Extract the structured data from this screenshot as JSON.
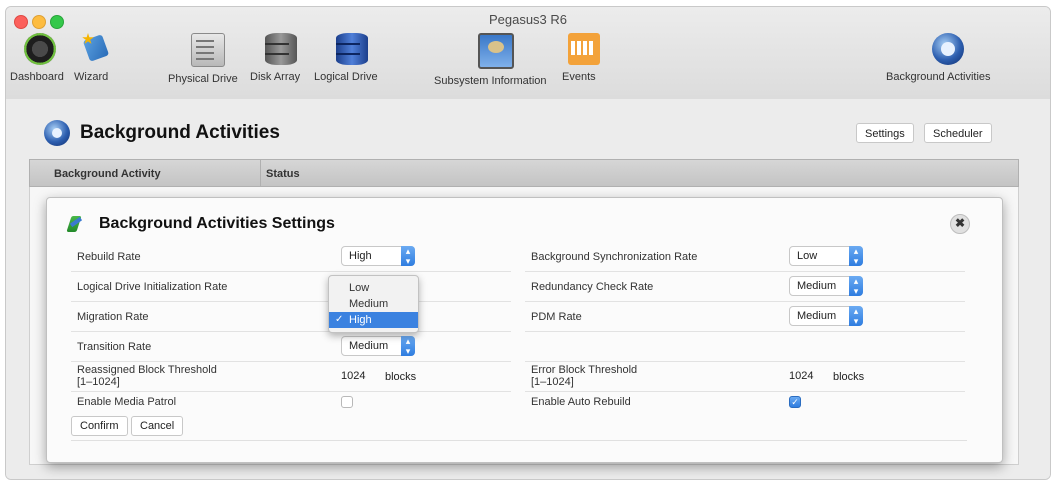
{
  "window": {
    "title": "Pegasus3 R6"
  },
  "toolbar": {
    "dashboard": "Dashboard",
    "wizard": "Wizard",
    "physical_drive": "Physical Drive",
    "disk_array": "Disk Array",
    "logical_drive": "Logical Drive",
    "subsystem_information": "Subsystem Information",
    "events": "Events",
    "background_activities": "Background Activities"
  },
  "page": {
    "title": "Background Activities",
    "settings_button": "Settings",
    "scheduler_button": "Scheduler"
  },
  "table": {
    "col_activity": "Background Activity",
    "col_status": "Status"
  },
  "dialog": {
    "title": "Background Activities Settings",
    "close_symbol": "✖",
    "left": {
      "rebuild_rate": {
        "label": "Rebuild Rate",
        "value": "High"
      },
      "ld_init_rate": {
        "label": "Logical Drive Initialization Rate"
      },
      "migration_rate": {
        "label": "Migration Rate"
      },
      "transition_rate": {
        "label": "Transition Rate",
        "value": "Medium"
      },
      "reassigned_block": {
        "label": "Reassigned Block Threshold",
        "range": "[1–1024]",
        "value": "1024",
        "unit": "blocks"
      },
      "media_patrol": {
        "label": "Enable Media Patrol",
        "checked": false
      }
    },
    "right": {
      "bg_sync_rate": {
        "label": "Background Synchronization Rate",
        "value": "Low"
      },
      "redundancy_rate": {
        "label": "Redundancy Check Rate",
        "value": "Medium"
      },
      "pdm_rate": {
        "label": "PDM Rate",
        "value": "Medium"
      },
      "error_block": {
        "label": "Error Block Threshold",
        "range": "[1–1024]",
        "value": "1024",
        "unit": "blocks"
      },
      "auto_rebuild": {
        "label": "Enable Auto Rebuild",
        "checked": true
      }
    },
    "confirm_button": "Confirm",
    "cancel_button": "Cancel",
    "dropdown": {
      "options": [
        "Low",
        "Medium",
        "High"
      ],
      "selected": "High",
      "check_mark": "✓"
    }
  },
  "colors": {
    "accent": "#3b82e0",
    "selected_option": "#3b82e0"
  }
}
